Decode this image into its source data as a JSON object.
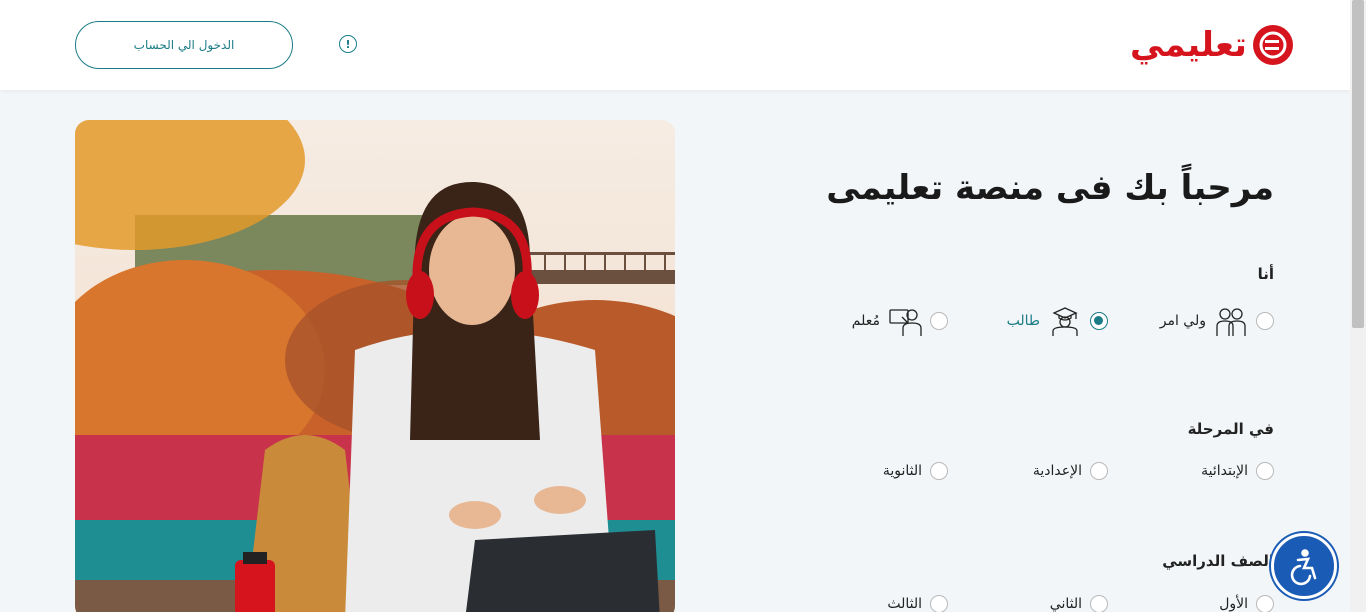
{
  "header": {
    "logo_text": "تعليمي",
    "login_label": "الدخول الي الحساب",
    "info_symbol": "!"
  },
  "form": {
    "welcome": "مرحباً بك فى منصة تعليمى",
    "role_label": "أنا",
    "roles": [
      {
        "label": "ولي امر",
        "icon": "parents-icon",
        "selected": false
      },
      {
        "label": "طالب",
        "icon": "graduate-icon",
        "selected": true
      },
      {
        "label": "مُعلم",
        "icon": "teacher-icon",
        "selected": false
      }
    ],
    "stage_label": "في المرحلة",
    "stages": [
      "الإبتدائية",
      "الإعدادية",
      "الثانوية"
    ],
    "grade_label": "الصف الدراسي",
    "grades": [
      "الأول",
      "الثاني",
      "الثالث"
    ]
  },
  "colors": {
    "brand_red": "#d6141e",
    "accent_teal": "#1b7c86",
    "accessibility_blue": "#1a5bb5",
    "background": "#f2f6f8"
  }
}
